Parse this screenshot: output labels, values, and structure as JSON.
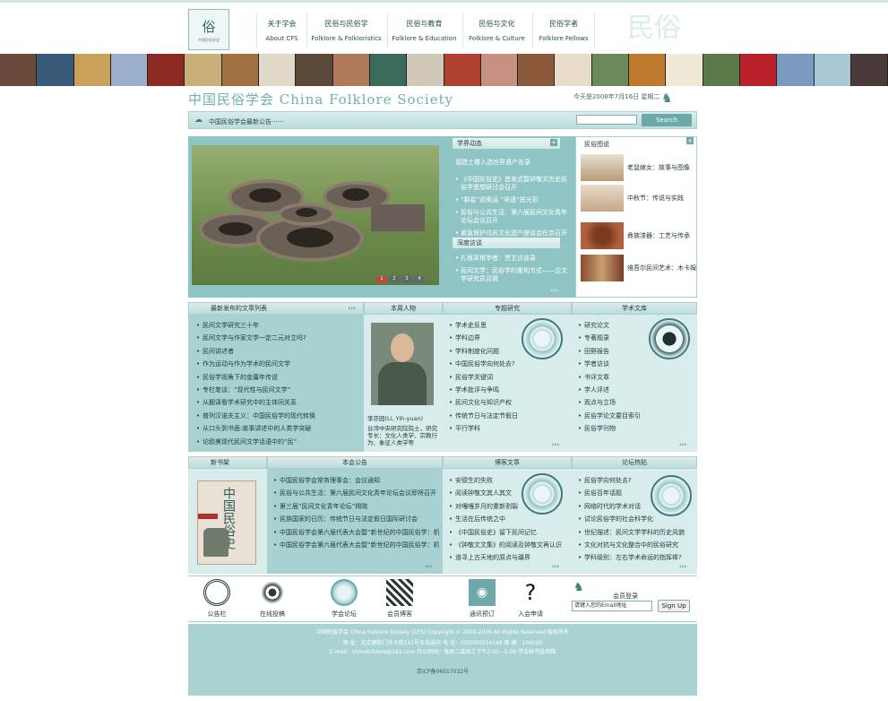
{
  "colors": {
    "accent": "#8fc4c4",
    "dark": "#3f7a7a",
    "header_bg": "#bcdcdc"
  },
  "logo": {
    "glyph": "俗",
    "sub": "中国民俗学会"
  },
  "nav": [
    {
      "zh": "关于学会",
      "en": "About CFS"
    },
    {
      "zh": "民俗与民俗学",
      "en": "Folklore & Folkloristics"
    },
    {
      "zh": "民俗与教育",
      "en": "Folklore & Education"
    },
    {
      "zh": "民俗与文化",
      "en": "Folklore & Culture"
    },
    {
      "zh": "民俗学者",
      "en": "Folklore Fellows"
    }
  ],
  "bg_char": "民俗",
  "site_title": "中国民俗学会 China Folklore Society",
  "date": "今天是2008年7月16日  星期二",
  "notice": "中国民俗学会最新公告······",
  "search": {
    "button": "Search",
    "placeholder": ""
  },
  "xuejie": {
    "title": "学界动态",
    "top": "福建土楼入选世界遗产名录",
    "items": [
      "《中国民俗史》首发式暨钟敬文历史民俗学思想研讨会召开",
      "“群星”迎奥运  “非遗”放光彩",
      "民俗与公共生活：第六届民间文化青年论坛会议召开",
      "紧急保护乌苏文化遗产座谈会在京召开"
    ]
  },
  "shendu": {
    "title": "深度访谈",
    "items": [
      "扎根草根学者：贾芝访谈录",
      "民间文学：民俗学的重构方式——访文学研究员吕微"
    ]
  },
  "more": "›››",
  "tujian": {
    "title": "民俗图说",
    "items": [
      "老鼠嫁女：故事与图像",
      "中秋节：传说与实践",
      "彝族漆器：工艺与传承",
      "维吾尔民间艺术：木卡姆"
    ]
  },
  "photo_pages": [
    "1",
    "2",
    "3",
    "4"
  ],
  "sec1": {
    "articles_title": "最新发布的文章列表",
    "articles": [
      "民间文学研究三十年",
      "民间文学与作家文学一定二元对立吗?",
      "民间讲述者",
      "作为运动与作为学术的民间文学",
      "民俗学视角下的金庸年传说",
      "专栏笔谈：“现代性与民间文学”",
      "从翻译看学术研究中的主体间关系",
      "普列汉诺夫主义：中国民俗学的现代转换",
      "从口头到书面:故事讲述中的人类学突破",
      "论欧美现代民间文学话语中的“民”"
    ],
    "person_title": "本周人物",
    "person_name": "李亦园(Li, Yih-yuan)",
    "person_desc": "台湾中央研究院院士，研究专长：文化人类学、宗教行为、象征人类学等",
    "topic_title": "专题研究",
    "topics": [
      "学术史反思",
      "学科边界",
      "学科制度化问题",
      "中国民俗学向何处去?",
      "民俗学关键词",
      "学术批评与争鸣",
      "民间文化与知识产权",
      "传统节日与法定节假日",
      "平行学科"
    ],
    "library_title": "学术文库",
    "library": [
      "研究论文",
      "专著题录",
      "田野报告",
      "学者访谈",
      "书评文章",
      "学人评述",
      "观点与立场",
      "民俗学论文要目索引",
      "民俗学刊物"
    ]
  },
  "sec2": {
    "books_title": "新书架",
    "book_title": "中国民俗史",
    "meeting_title": "本会公告",
    "meetings": [
      "中国民俗学会常务理事会：会议通知",
      "民俗与公共生活：第六届民间文化青年论坛会议即将召开",
      "第三届“民间文化青年论坛”揭晓",
      "民族国家的日历：传统节日与法定假日国际研讨会",
      "中国民俗学会第六届代表大会暨“新世纪的中国民俗学：机遇与挑战”参会论文",
      "中国民俗学会第六届代表大会暨“新世纪的中国民俗学：机遇与挑战”同上讨论通知"
    ],
    "blog_title": "博客文章",
    "blogs": [
      "安德生的失败",
      "阅读钟敬文其人其文",
      "对嘎嘎岁月的重新割裂",
      "生活在后传统之中",
      "《中国民俗史》留下民间记忆",
      "《钟敬文文集》的阅读及钟敬文再认识",
      "道寻上古天地的原点与疆界"
    ],
    "forum_title": "论坛热贴",
    "forums": [
      "民俗学向何处去?",
      "民俗百年话题",
      "网络时代的学术对话",
      "试论民俗学的社会科学化",
      "世纪描述：民间文学学科的历史风貌",
      "文化对抗与文化整合中的民俗研究",
      "学科级别：左右学术命运的指挥棒?"
    ]
  },
  "bottom": {
    "items": [
      "公告栏",
      "在线投稿",
      "学会论坛",
      "会员博客",
      "通讯预订",
      "入会申请"
    ],
    "login_title": "会员登录",
    "login_placeholder": "请键入您的Email地址",
    "login_button": "Sign Up"
  },
  "footer": {
    "l1": "中国民俗学会  China Folklore Society (CFS)  Copyright © 2003-2006  All Rights Reserved  版权所有",
    "l2": "地  址：北京朝阳门外大街141号东岳庙内    电  话：(010)65514149    邮  编：100020",
    "l3": "E-mail：chinafolklore@163.com    办公时间：每周二或周三下午2:00—5:00    学会秘书处邮箱",
    "l4": "京ICP备06017032号"
  }
}
